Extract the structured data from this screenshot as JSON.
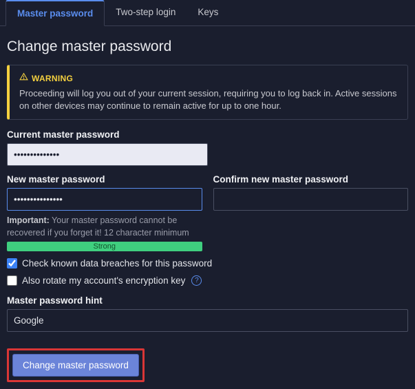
{
  "tabs": {
    "master_password": "Master password",
    "two_step_login": "Two-step login",
    "keys": "Keys"
  },
  "heading": "Change master password",
  "warning": {
    "title": "WARNING",
    "body": "Proceeding will log you out of your current session, requiring you to log back in. Active sessions on other devices may continue to remain active for up to one hour."
  },
  "current": {
    "label": "Current master password",
    "value": "••••••••••••••"
  },
  "new": {
    "label": "New master password",
    "value": "•••••••••••••••",
    "important_label": "Important:",
    "important_text": " Your master password cannot be recovered if you forget it! 12 character minimum",
    "strength": "Strong"
  },
  "confirm": {
    "label": "Confirm new master password",
    "value": ""
  },
  "checks": {
    "breach": "Check known data breaches for this password",
    "rotate": "Also rotate my account's encryption key"
  },
  "hint": {
    "label": "Master password hint",
    "value": "Google"
  },
  "submit": "Change master password"
}
